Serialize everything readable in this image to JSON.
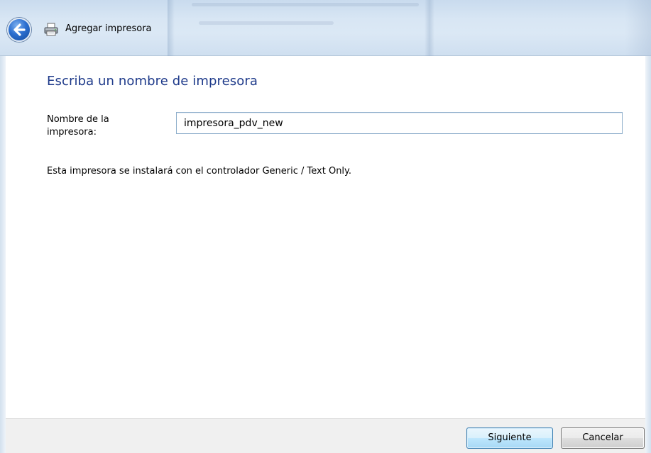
{
  "window": {
    "title": "Agregar impresora"
  },
  "page": {
    "heading": "Escriba un nombre de impresora",
    "printer_name_label": "Nombre de la\nimpresora:",
    "printer_name_value": "impresora_pdv_new",
    "driver_note": "Esta impresora se instalará con el controlador Generic / Text Only."
  },
  "footer": {
    "next_label": "Siguiente",
    "cancel_label": "Cancelar"
  },
  "icons": {
    "back": "back-arrow-icon",
    "printer": "printer-icon"
  },
  "colors": {
    "heading": "#1e3a8a",
    "back_button": "#2c6fd0",
    "next_button_border": "#3c7fb1"
  }
}
